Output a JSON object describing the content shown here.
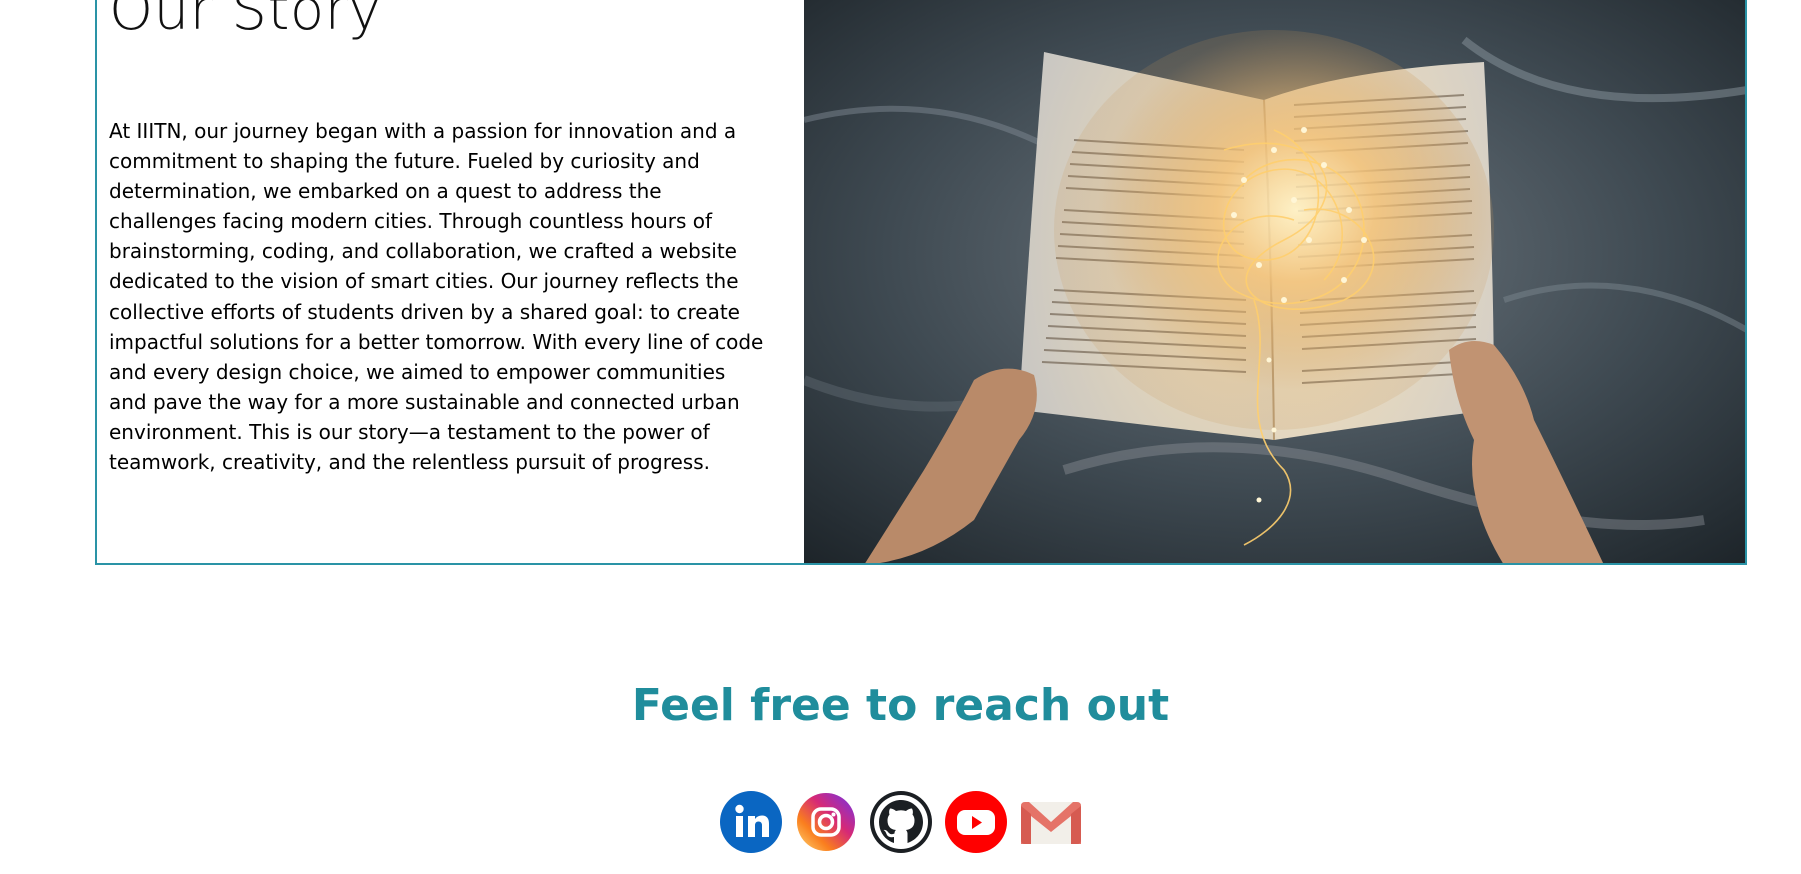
{
  "story": {
    "title": "Our Story",
    "body": "At IIITN, our journey began with a passion for innovation and a commitment to shaping the future. Fueled by curiosity and determination, we embarked on a quest to address the challenges facing modern cities. Through countless hours of brainstorming, coding, and collaboration, we crafted a website dedicated to the vision of smart cities. Our journey reflects the collective efforts of students driven by a shared goal: to create impactful solutions for a better tomorrow. With every line of code and every design choice, we aimed to empower communities and pave the way for a more sustainable and connected urban environment. This is our story—a testament to the power of teamwork, creativity, and the relentless pursuit of progress."
  },
  "contact": {
    "heading": "Feel free to reach out",
    "socials": [
      {
        "icon": "linkedin-icon",
        "color": "#0a66c2"
      },
      {
        "icon": "instagram-icon",
        "color": "#e1306c"
      },
      {
        "icon": "github-icon",
        "color": "#1b1f23"
      },
      {
        "icon": "youtube-icon",
        "color": "#ff0000"
      },
      {
        "icon": "gmail-icon",
        "color": "#ea4335"
      }
    ]
  },
  "colors": {
    "accent": "#208d9c",
    "card_border": "#2a93a6"
  }
}
